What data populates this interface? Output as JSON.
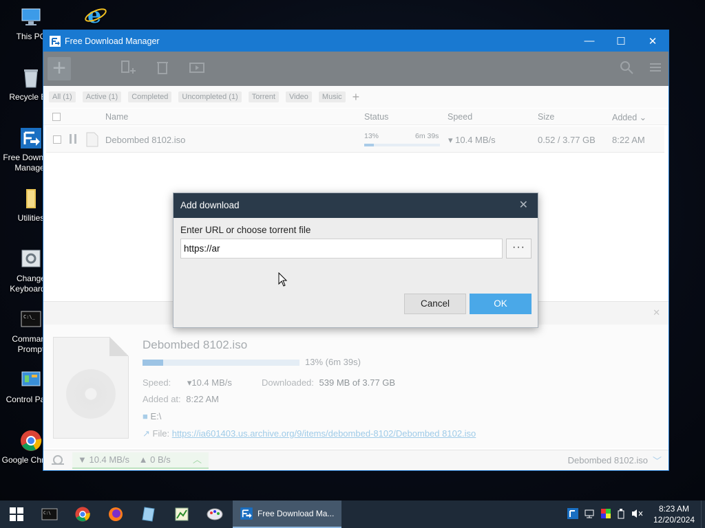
{
  "desktop": {
    "icons": [
      {
        "label": "This PC"
      },
      {
        "label": ""
      },
      {
        "label": "Recycle Bin"
      },
      {
        "label": "Free Download Manager"
      },
      {
        "label": "Utilities"
      },
      {
        "label": "Change Keyboard L"
      },
      {
        "label": "Command Prompt"
      },
      {
        "label": "Control Panel"
      },
      {
        "label": "Google Chrome"
      }
    ]
  },
  "window": {
    "title": "Free Download Manager",
    "controls": {
      "minimize": "—",
      "maximize": "☐",
      "close": "✕"
    }
  },
  "filters": [
    "All (1)",
    "Active (1)",
    "Completed",
    "Uncompleted (1)",
    "Torrent",
    "Video",
    "Music",
    "+"
  ],
  "list": {
    "columns": {
      "name": "Name",
      "status": "Status",
      "speed": "Speed",
      "size": "Size",
      "added": "Added ⌄"
    },
    "rows": [
      {
        "name": "Debombed 8102.iso",
        "progress_label": "13%",
        "progress": 0.13,
        "eta": "6m 39s",
        "speed": "▾ 10.4 MB/s",
        "size": "0.52 / 3.77 GB",
        "added": "8:22 AM"
      }
    ]
  },
  "details": {
    "name": "Debombed 8102.iso",
    "progress": 0.13,
    "progress_text": "13% (6m 39s)",
    "speed_label": "Speed:",
    "speed_value": "▾10.4 MB/s",
    "downloaded_label": "Downloaded:",
    "downloaded_value": "539 MB of 3.77 GB",
    "added_label": "Added at:",
    "added_value": "8:22 AM",
    "folder": "E:\\",
    "file_label": "File:",
    "file_url": "https://ia601403.us.archive.org/9/items/debombed-8102/Debombed 8102.iso"
  },
  "statusbar": {
    "down_speed": "▼ 10.4 MB/s",
    "up_speed": "▲ 0 B/s",
    "current_file": "Debombed 8102.iso"
  },
  "dialog": {
    "title": "Add download",
    "close": "✕",
    "label": "Enter URL or choose torrent file",
    "url_value": "https://ar",
    "browse": "···",
    "cancel": "Cancel",
    "ok": "OK"
  },
  "taskbar": {
    "active_app": "Free Download Ma...",
    "time": "8:23 AM",
    "date": "12/20/2024"
  },
  "colors": {
    "titlebar": "#1979d1",
    "accent": "#4aa8e8",
    "dialog_header": "#2a3a4a",
    "taskbar": "#1e2a38"
  }
}
